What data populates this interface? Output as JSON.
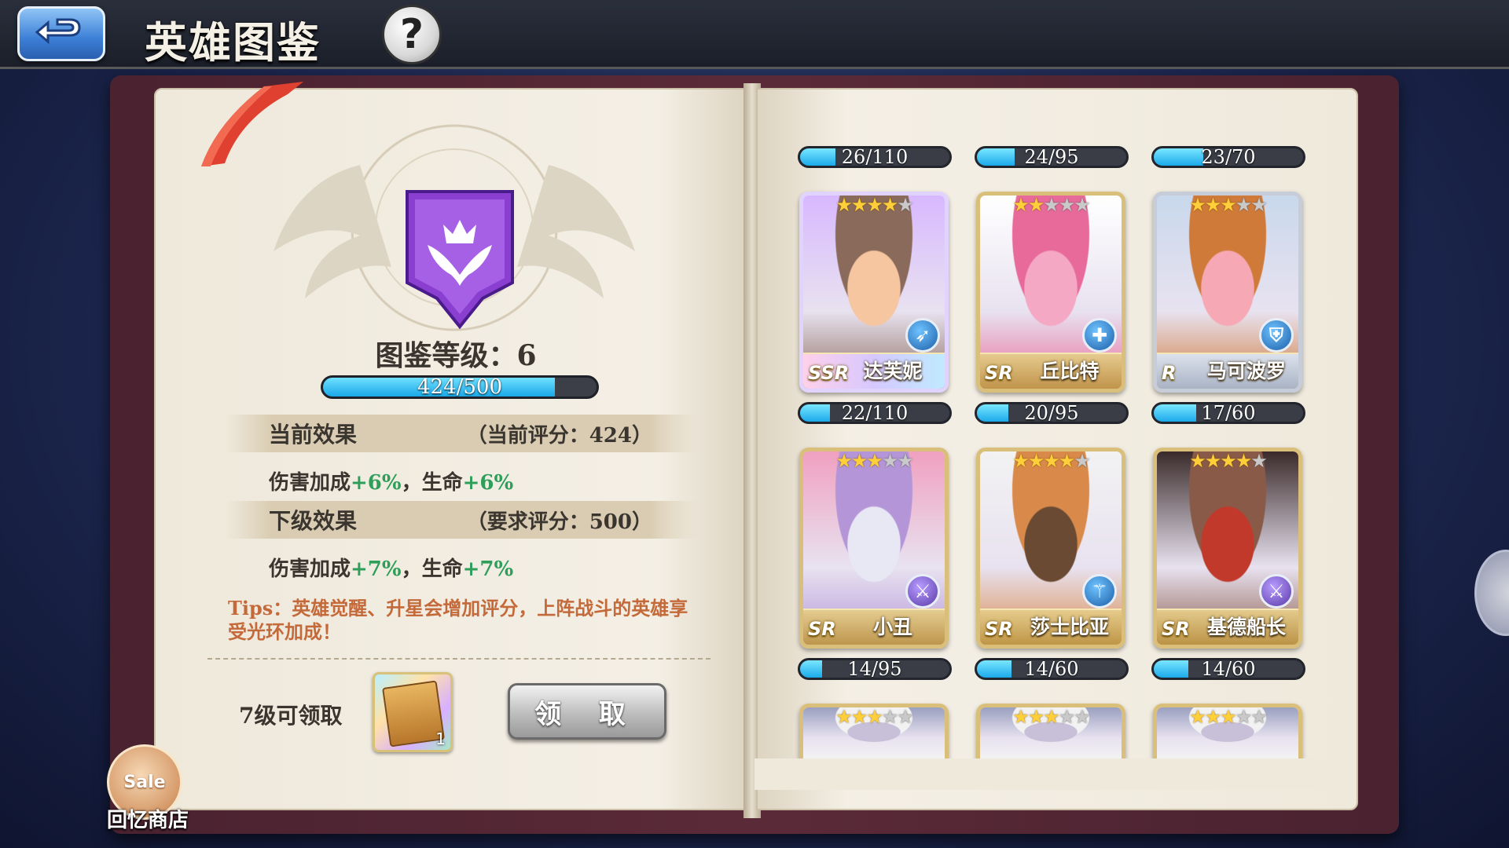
{
  "header": {
    "title": "英雄图鉴",
    "back_icon": "back-arrow-icon",
    "help_label": "?"
  },
  "collection": {
    "level_text": "图鉴等级：6",
    "xp_current": 424,
    "xp_max": 500,
    "xp_label": "424/500",
    "current_effect": {
      "name": "当前效果",
      "score": "（当前评分：424）",
      "damage_label": "伤害加成",
      "damage_value": "+6%",
      "sep": "，",
      "life_label": "生命",
      "life_value": "+6%"
    },
    "next_effect": {
      "name": "下级效果",
      "score": "（要求评分：500）",
      "damage_label": "伤害加成",
      "damage_value": "+7%",
      "sep": "，",
      "life_label": "生命",
      "life_value": "+7%"
    },
    "tips": "Tips：英雄觉醒、升星会增加评分，上阵战斗的英雄享受光环加成！",
    "reward": {
      "label": "7级可领取",
      "item_count": "1",
      "claim_label": "领 取"
    }
  },
  "sale_shop": {
    "badge": "Sale",
    "label": "回忆商店"
  },
  "heroes": [
    {
      "progress": "26/110",
      "fill": 0.236,
      "stars": 4,
      "rarity": "SSR",
      "name": "达芙妮",
      "role_icon": "bow-icon",
      "colors": [
        "#f6c6a0",
        "#8a6a5a",
        "#d8b8ff"
      ]
    },
    {
      "progress": "24/95",
      "fill": 0.253,
      "stars": 2,
      "rarity": "SR",
      "name": "丘比特",
      "role_icon": "heal-cross-icon",
      "colors": [
        "#f4a8c4",
        "#e86a9a",
        "#ffffff"
      ]
    },
    {
      "progress": "23/70",
      "fill": 0.329,
      "stars": 3,
      "rarity": "R",
      "name": "马可波罗",
      "role_icon": "shield-icon",
      "colors": [
        "#f6a8b4",
        "#d07a3a",
        "#c9d8ec"
      ]
    },
    {
      "progress": "22/110",
      "fill": 0.2,
      "stars": 3,
      "rarity": "SR",
      "name": "小丑",
      "role_icon": "crossed-swords-icon",
      "colors": [
        "#e8e8f4",
        "#b496d8",
        "#f0a0c0"
      ]
    },
    {
      "progress": "20/95",
      "fill": 0.21,
      "stars": 4,
      "rarity": "SR",
      "name": "莎士比亚",
      "role_icon": "staff-icon",
      "colors": [
        "#6a4a32",
        "#d98a4a",
        "#f2f2f2"
      ]
    },
    {
      "progress": "17/60",
      "fill": 0.283,
      "stars": 4,
      "rarity": "SR",
      "name": "基德船长",
      "role_icon": "crossed-swords-icon",
      "colors": [
        "#c0392b",
        "#8a5a48",
        "#3a2a2a"
      ]
    },
    {
      "progress": "14/95",
      "fill": 0.147,
      "stars": 3
    },
    {
      "progress": "14/60",
      "fill": 0.233,
      "stars": 3
    },
    {
      "progress": "14/60",
      "fill": 0.233,
      "stars": 3
    }
  ],
  "colors": {
    "accent_blue": "#1aa8e8",
    "green_bonus": "#2e9e5a",
    "tips_orange": "#c46a3a",
    "emblem_purple": "#8a3fd0"
  }
}
